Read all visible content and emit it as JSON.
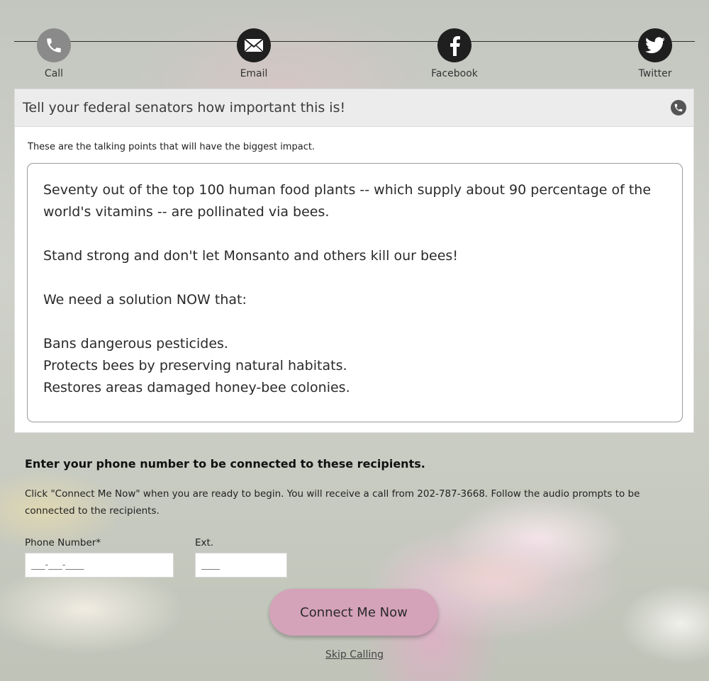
{
  "share": {
    "items": [
      {
        "label": "Call",
        "icon": "phone-icon"
      },
      {
        "label": "Email",
        "icon": "envelope-icon"
      },
      {
        "label": "Facebook",
        "icon": "facebook-icon"
      },
      {
        "label": "Twitter",
        "icon": "twitter-icon"
      }
    ]
  },
  "panel": {
    "title": "Tell your federal senators how important this is!",
    "subtitle": "These are the talking points that will have the biggest impact.",
    "talking_points": {
      "p1": "Seventy out of the top 100 human food plants -- which supply about 90 percentage of the world's vitamins -- are pollinated via bees.",
      "p2": "Stand strong and don't let Monsanto and others kill our bees!",
      "p3": "We need a solution NOW that:",
      "l1": "Bans dangerous pesticides.",
      "l2": "Protects bees by preserving natural habitats.",
      "l3": "Restores areas damaged honey-bee colonies."
    }
  },
  "phone": {
    "heading": "Enter your phone number to be connected to these recipients.",
    "description": "Click \"Connect Me Now\" when you are ready to begin. You will receive a call from 202-787-3668. Follow the audio prompts to be connected to the recipients.",
    "phone_label": "Phone Number*",
    "phone_placeholder": "___-___-____",
    "ext_label": "Ext.",
    "ext_placeholder": "____",
    "connect_label": "Connect Me Now",
    "skip_label": "Skip Calling"
  },
  "colors": {
    "button": "#d4a2b9",
    "icon_dark": "#1f1f1f",
    "icon_active": "#8a8a8a"
  }
}
